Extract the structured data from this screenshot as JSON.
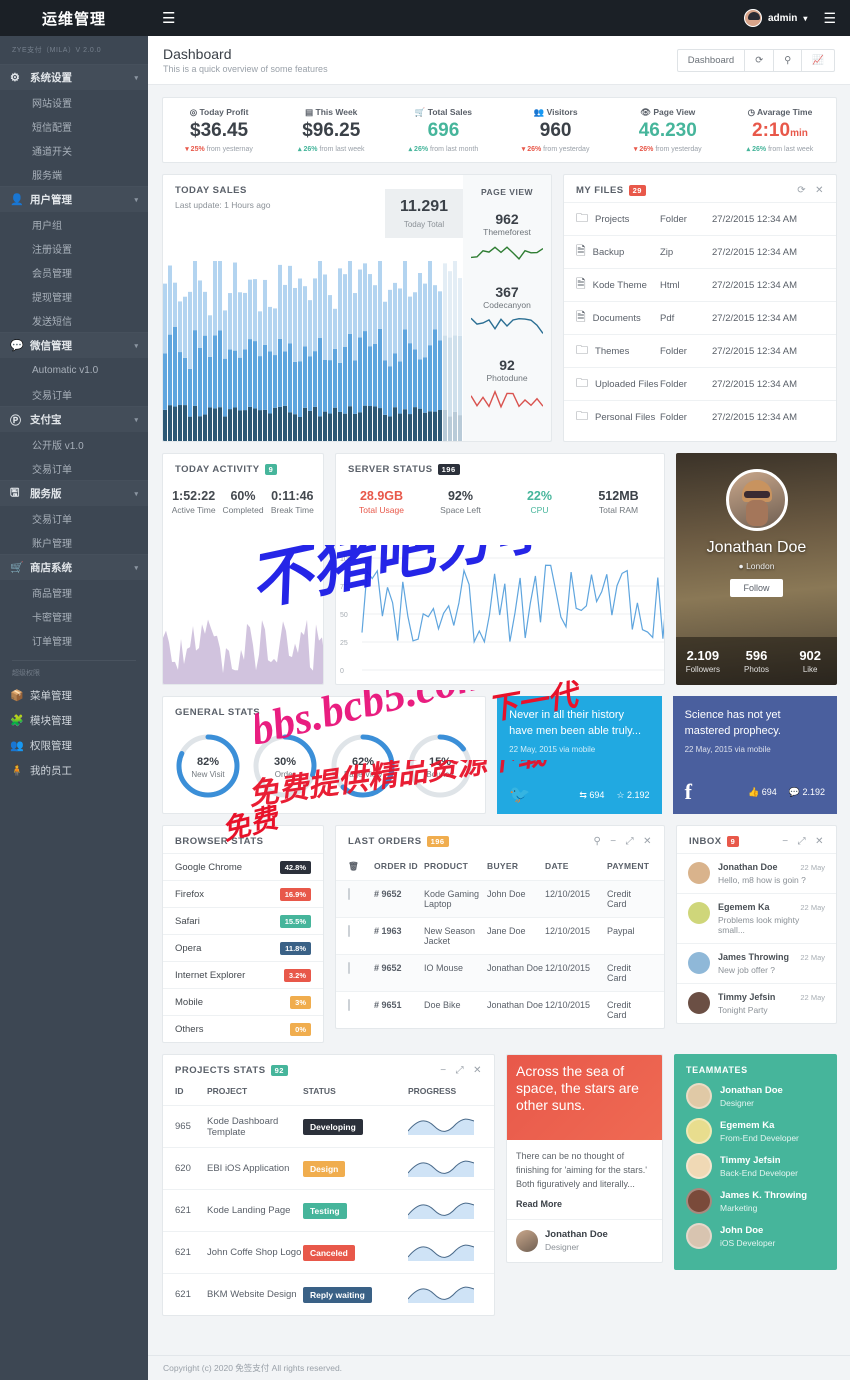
{
  "sidebar": {
    "brand": "运维管理",
    "version": "ZYE支付（MILA）V 2.0.0",
    "groups": [
      {
        "icon": "gear-icon",
        "glyph": "⚙",
        "label": "系统设置",
        "children": [
          "网站设置",
          "短信配置",
          "通道开关",
          "服务端"
        ]
      },
      {
        "icon": "user-icon",
        "glyph": "👤",
        "label": "用户管理",
        "children": [
          "用户组",
          "注册设置",
          "会员管理",
          "提现管理",
          "发送短信"
        ]
      },
      {
        "icon": "wechat-icon",
        "glyph": "💬",
        "label": "微信管理",
        "children": [
          "Automatic v1.0",
          "交易订单"
        ]
      },
      {
        "icon": "alipay-icon",
        "glyph": "Ⓟ",
        "label": "支付宝",
        "children": [
          "公开版 v1.0",
          "交易订单"
        ]
      },
      {
        "icon": "server-icon",
        "glyph": "🖫",
        "label": "服务版",
        "children": [
          "交易订单",
          "账户管理"
        ]
      },
      {
        "icon": "cart-icon",
        "glyph": "🛒",
        "label": "商店系统",
        "children": [
          "商品管理",
          "卡密管理",
          "订单管理"
        ]
      }
    ],
    "section_title": "超级权限",
    "plain_items": [
      {
        "icon": "box-icon",
        "glyph": "📦",
        "label": "菜单管理"
      },
      {
        "icon": "puzzle-icon",
        "glyph": "🧩",
        "label": "模块管理"
      },
      {
        "icon": "group-icon",
        "glyph": "👥",
        "label": "权限管理"
      },
      {
        "icon": "staff-icon",
        "glyph": "🧍",
        "label": "我的员工"
      }
    ]
  },
  "topbar": {
    "menu_icon": "hamburger-icon",
    "user": "admin",
    "caret": "▾",
    "right_icon": "panel-toggle-icon"
  },
  "pagehead": {
    "title": "Dashboard",
    "subtitle": "This is a quick overview of some features",
    "buttons": [
      "Dashboard"
    ],
    "icons": [
      "refresh-icon",
      "search-icon",
      "chart-icon"
    ]
  },
  "stats": [
    {
      "icon": "clock-icon",
      "glyph": "◎",
      "label": "Today Profit",
      "value": "$36.45",
      "color": "#3b4148",
      "delta": "25%",
      "delta_color": "#e8584a",
      "delta_text": "from yesternay",
      "arrow": "▾"
    },
    {
      "icon": "calendar-icon",
      "glyph": "▤",
      "label": "This Week",
      "value": "$96.25",
      "color": "#3b4148",
      "delta": "26%",
      "delta_color": "#46b59b",
      "delta_text": "from last week",
      "arrow": "▴"
    },
    {
      "icon": "cart-icon",
      "glyph": "🛒",
      "label": "Total Sales",
      "value": "696",
      "color": "#46b59b",
      "delta": "26%",
      "delta_color": "#46b59b",
      "delta_text": "from last month",
      "arrow": "▴"
    },
    {
      "icon": "visitors-icon",
      "glyph": "👥",
      "label": "Visitors",
      "value": "960",
      "color": "#3b4148",
      "delta": "26%",
      "delta_color": "#e8584a",
      "delta_text": "from yesterday",
      "arrow": "▾"
    },
    {
      "icon": "eye-icon",
      "glyph": "👁",
      "label": "Page View",
      "value": "46.230",
      "color": "#46b59b",
      "delta": "26%",
      "delta_color": "#e8584a",
      "delta_text": "from yesterday",
      "arrow": "▾"
    },
    {
      "icon": "timer-icon",
      "glyph": "◷",
      "label": "Avarage Time",
      "value": "2:10",
      "suffix": "min",
      "color": "#e8584a",
      "delta": "26%",
      "delta_color": "#46b59b",
      "delta_text": "from last week",
      "arrow": "▴"
    }
  ],
  "today_sales": {
    "title": "TODAY SALES",
    "subtitle": "Last update: 1 Hours ago",
    "total_value": "11.291",
    "total_label": "Today Total",
    "pageview_title": "PAGE VIEW",
    "pageview_items": [
      {
        "value": "962",
        "label": "Themeforest",
        "color": "#2e7d32"
      },
      {
        "value": "367",
        "label": "Codecanyon",
        "color": "#2a6e93"
      },
      {
        "value": "92",
        "label": "Photodune",
        "color": "#d9534f"
      }
    ]
  },
  "my_files": {
    "title": "MY FILES",
    "badge": "29",
    "badge_color": "#e8584a",
    "icons": [
      "refresh-icon",
      "close-icon"
    ],
    "rows": [
      {
        "name": "Projects",
        "icon": "folder-icon",
        "type": "Folder",
        "date": "27/2/2015 12:34 AM"
      },
      {
        "name": "Backup",
        "icon": "zip-file-icon",
        "type": "Zip",
        "date": "27/2/2015 12:34 AM"
      },
      {
        "name": "Kode Theme",
        "icon": "code-file-icon",
        "type": "Html",
        "date": "27/2/2015 12:34 AM"
      },
      {
        "name": "Documents",
        "icon": "pdf-file-icon",
        "type": "Pdf",
        "date": "27/2/2015 12:34 AM"
      },
      {
        "name": "Themes",
        "icon": "folder-icon",
        "type": "Folder",
        "date": "27/2/2015 12:34 AM"
      },
      {
        "name": "Uploaded Files",
        "icon": "folder-icon",
        "type": "Folder",
        "date": "27/2/2015 12:34 AM"
      },
      {
        "name": "Personal Files",
        "icon": "folder-icon",
        "type": "Folder",
        "date": "27/2/2015 12:34 AM"
      }
    ]
  },
  "today_activity": {
    "title": "TODAY ACTIVITY",
    "badge": "9",
    "badge_color": "#46b59b",
    "metrics": [
      {
        "value": "1:52:22",
        "label": "Active Time"
      },
      {
        "value": "60%",
        "label": "Completed"
      },
      {
        "value": "0:11:46",
        "label": "Break Time"
      }
    ]
  },
  "server_status": {
    "title": "SERVER STATUS",
    "badge": "196",
    "badge_color": "#2b303a",
    "metrics": [
      {
        "value": "28.9GB",
        "label": "Total Usage",
        "color": "#e8584a",
        "label_color": "#e8584a"
      },
      {
        "value": "92%",
        "label": "Space Left",
        "color": "#3b4148",
        "label_color": "#72787e"
      },
      {
        "value": "22%",
        "label": "CPU",
        "color": "#46b59b",
        "label_color": "#46b59b"
      },
      {
        "value": "512MB",
        "label": "Total RAM",
        "color": "#3b4148",
        "label_color": "#72787e"
      }
    ],
    "yticks": [
      "100",
      "75",
      "50",
      "25",
      "0"
    ]
  },
  "profile": {
    "name": "Jonathan Doe",
    "location": "London",
    "location_icon": "pin-icon",
    "follow_label": "Follow",
    "stats": [
      {
        "value": "2.109",
        "label": "Followers"
      },
      {
        "value": "596",
        "label": "Photos"
      },
      {
        "value": "902",
        "label": "Like"
      }
    ]
  },
  "general_stats": {
    "title": "GENERAL STATS",
    "donuts": [
      {
        "pct": "82%",
        "label": "New Visit",
        "value": 82,
        "color": "#3b8fd8"
      },
      {
        "pct": "30%",
        "label": "Order",
        "value": 30,
        "color": "#3b8fd8"
      },
      {
        "pct": "62%",
        "label": "Page View",
        "value": 62,
        "color": "#3b8fd8"
      },
      {
        "pct": "15%",
        "label": "Bounce",
        "value": 15,
        "color": "#3b8fd8"
      }
    ]
  },
  "twitter_card": {
    "quote": "Never in all their history have men been able truly...",
    "date": "22 May, 2015 via mobile",
    "icon": "twitter-icon",
    "retweets": "694",
    "favorites": "2.192",
    "bg": "#21a9e1"
  },
  "facebook_card": {
    "quote": "Science has not yet mastered prophecy.",
    "date": "22 May, 2015 via mobile",
    "icon": "facebook-icon",
    "likes": "694",
    "comments": "2.192",
    "bg": "#4a5f9e"
  },
  "browser_stats": {
    "title": "BROWSER STATS",
    "rows": [
      {
        "name": "Google Chrome",
        "pct": "42.8%",
        "color": "#2b303a"
      },
      {
        "name": "Firefox",
        "pct": "16.9%",
        "color": "#e8584a"
      },
      {
        "name": "Safari",
        "pct": "15.5%",
        "color": "#46b59b"
      },
      {
        "name": "Opera",
        "pct": "11.8%",
        "color": "#3a6186"
      },
      {
        "name": "Internet Explorer",
        "pct": "3.2%",
        "color": "#e8584a"
      },
      {
        "name": "Mobile",
        "pct": "3%",
        "color": "#f0ad4e"
      },
      {
        "name": "Others",
        "pct": "0%",
        "color": "#f0ad4e"
      }
    ]
  },
  "last_orders": {
    "title": "LAST ORDERS",
    "badge": "196",
    "badge_color": "#f0ad4e",
    "icons": [
      "search-icon",
      "minimize-icon",
      "expand-icon",
      "close-icon"
    ],
    "columns": [
      "",
      "ORDER ID",
      "PRODUCT",
      "BUYER",
      "DATE",
      "PAYMENT"
    ],
    "trash_icon": "trash-icon",
    "rows": [
      {
        "id": "# 9652",
        "product": "Kode Gaming Laptop",
        "buyer": "John Doe",
        "date": "12/10/2015",
        "payment": "Credit Card"
      },
      {
        "id": "# 1963",
        "product": "New Season Jacket",
        "buyer": "Jane Doe",
        "date": "12/10/2015",
        "payment": "Paypal"
      },
      {
        "id": "# 9652",
        "product": "IO Mouse",
        "buyer": "Jonathan Doe",
        "date": "12/10/2015",
        "payment": "Credit Card"
      },
      {
        "id": "# 9651",
        "product": "Doe Bike",
        "buyer": "Jonathan Doe",
        "date": "12/10/2015",
        "payment": "Credit Card"
      }
    ]
  },
  "inbox": {
    "title": "INBOX",
    "badge": "9",
    "badge_color": "#e8584a",
    "icons": [
      "minimize-icon",
      "expand-icon",
      "close-icon"
    ],
    "rows": [
      {
        "name": "Jonathan Doe",
        "msg": "Hello, m8 how is goin ?",
        "date": "22 May",
        "avatar": "#d9b38c"
      },
      {
        "name": "Egemem Ka",
        "msg": "Problems look mighty small...",
        "date": "22 May",
        "avatar": "#cfd67a"
      },
      {
        "name": "James Throwing",
        "msg": "New job offer ?",
        "date": "22 May",
        "avatar": "#8fb8d8"
      },
      {
        "name": "Timmy Jefsin",
        "msg": "Tonight Party",
        "date": "22 May",
        "avatar": "#6b4f44"
      }
    ]
  },
  "projects_stats": {
    "title": "PROJECTS STATS",
    "badge": "92",
    "badge_color": "#46b59b",
    "icons": [
      "minimize-icon",
      "expand-icon",
      "close-icon"
    ],
    "columns": [
      "ID",
      "PROJECT",
      "STATUS",
      "PROGRESS"
    ],
    "rows": [
      {
        "id": "965",
        "project": "Kode Dashboard Template",
        "status": "Developing",
        "status_color": "#2b303a"
      },
      {
        "id": "620",
        "project": "EBI iOS Application",
        "status": "Design",
        "status_color": "#f0ad4e"
      },
      {
        "id": "621",
        "project": "Kode Landing Page",
        "status": "Testing",
        "status_color": "#46b59b"
      },
      {
        "id": "621",
        "project": "John Coffe Shop Logo",
        "status": "Canceled",
        "status_color": "#e8584a"
      },
      {
        "id": "621",
        "project": "BKM Website Design",
        "status": "Reply waiting",
        "status_color": "#3a6186"
      }
    ]
  },
  "article": {
    "headline": "Across the sea of space, the stars are other suns.",
    "body": "There can be no thought of finishing for 'aiming for the stars.' Both figuratively and literally...",
    "read_more": "Read More",
    "author": "Jonathan Doe",
    "role": "Designer"
  },
  "teammates": {
    "title": "TEAMMATES",
    "rows": [
      {
        "name": "Jonathan Doe",
        "role": "Designer",
        "avatar": "#e0c9a6"
      },
      {
        "name": "Egemem Ka",
        "role": "From-End Developer",
        "avatar": "#e8dd8e"
      },
      {
        "name": "Timmy Jefsin",
        "role": "Back-End Developer",
        "avatar": "#f0d9b5"
      },
      {
        "name": "James K. Throwing",
        "role": "Marketing",
        "avatar": "#7a4a3a"
      },
      {
        "name": "John Doe",
        "role": "iOS Developer",
        "avatar": "#d8c4b0"
      }
    ]
  },
  "footer": {
    "text": "Copyright (c) 2020 免签支付 All rights reserved."
  },
  "watermarks": [
    "不猪吧分享",
    "bbs.bcb5.com",
    "免费提供精品资源下载"
  ]
}
